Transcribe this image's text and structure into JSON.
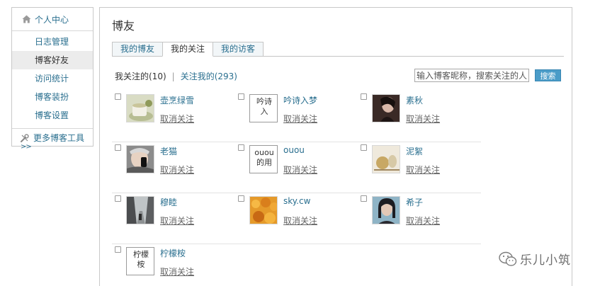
{
  "sidebar": {
    "header_label": "个人中心",
    "header_icon": "home-icon",
    "items": [
      {
        "label": "日志管理",
        "active": false
      },
      {
        "label": "博客好友",
        "active": true
      },
      {
        "label": "访问统计",
        "active": false
      },
      {
        "label": "博客装扮",
        "active": false
      },
      {
        "label": "博客设置",
        "active": false
      }
    ],
    "footer_label": "更多博客工具",
    "footer_icon": "tools-icon",
    "more_arrow": ">>"
  },
  "main": {
    "title": "博友",
    "tabs": [
      {
        "label": "我的博友",
        "active": false
      },
      {
        "label": "我的关注",
        "active": true
      },
      {
        "label": "我的访客",
        "active": false
      }
    ],
    "filter": {
      "current_label": "我关注的(10)",
      "separator": "|",
      "other_label": "关注我的(293)"
    },
    "search": {
      "placeholder": "输入博客昵称，搜索关注的人",
      "button_label": "搜索"
    },
    "unfollow_label": "取消关注",
    "friends": [
      {
        "name": "壶烹绿雪",
        "avatar": "tea-cup-photo"
      },
      {
        "name": "吟诗入梦",
        "avatar": "broken-image",
        "alt_text": "吟诗入"
      },
      {
        "name": "素秋",
        "avatar": "portrait-photo"
      },
      {
        "name": "老猫",
        "avatar": "man-phone-photo"
      },
      {
        "name": "ouou",
        "avatar": "broken-image",
        "alt_text": "ouou的用"
      },
      {
        "name": "泥絮",
        "avatar": "still-life-photo"
      },
      {
        "name": "穆睦",
        "avatar": "street-photo"
      },
      {
        "name": "sky.cw",
        "avatar": "orange-flowers-photo"
      },
      {
        "name": "希子",
        "avatar": "girl-portrait-photo"
      },
      {
        "name": "柠檬桉",
        "avatar": "broken-image",
        "alt_text": "柠檬桉"
      }
    ]
  },
  "watermark": {
    "text": "乐儿小筑",
    "icon": "wechat-icon"
  },
  "colors": {
    "link": "#2a6f8f",
    "button": "#4a9cc8",
    "active_bg": "#ececec"
  }
}
